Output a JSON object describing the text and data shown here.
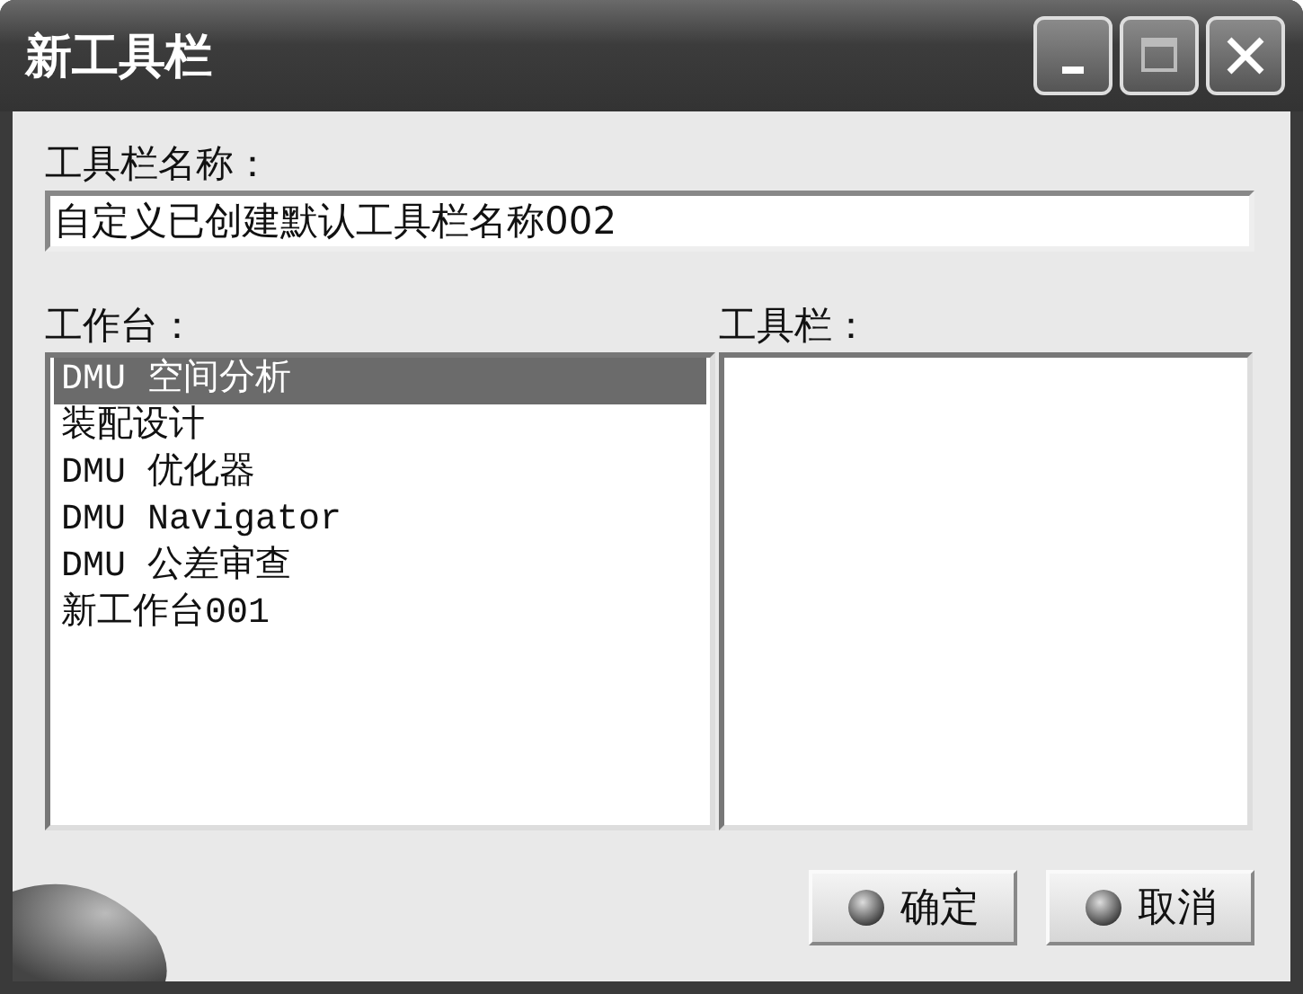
{
  "window": {
    "title": "新工具栏"
  },
  "toolbar_name": {
    "label": "工具栏名称：",
    "value": "自定义已创建默认工具栏名称002"
  },
  "workbenches": {
    "label": "工作台：",
    "items": [
      {
        "label": "DMU 空间分析",
        "selected": true
      },
      {
        "label": "装配设计",
        "selected": false
      },
      {
        "label": "DMU 优化器",
        "selected": false
      },
      {
        "label": "DMU Navigator",
        "selected": false
      },
      {
        "label": "DMU 公差审查",
        "selected": false
      },
      {
        "label": "新工作台001",
        "selected": false
      }
    ]
  },
  "toolbars": {
    "label": "工具栏："
  },
  "buttons": [
    {
      "label": "确定"
    },
    {
      "label": "取消"
    }
  ]
}
